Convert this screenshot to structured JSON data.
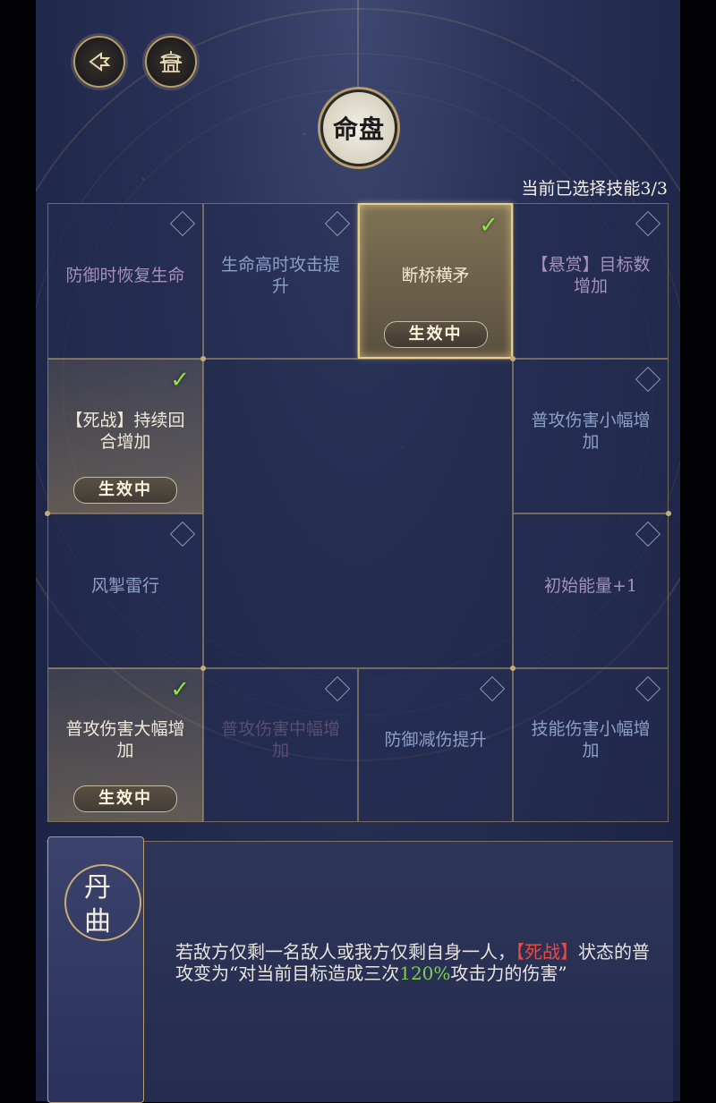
{
  "header": {
    "back_icon": "back-arrow-icon",
    "home_icon": "pavilion-icon",
    "emblem_title": "命盘",
    "selection_count": "当前已选择技能3/3"
  },
  "skills": [
    {
      "name": "防御时恢复生命",
      "state": "unselected",
      "color": "purple"
    },
    {
      "name": "生命高时攻击提升",
      "state": "unselected",
      "color": "blue"
    },
    {
      "name": "断桥横矛",
      "state": "selected",
      "badge": "生效中"
    },
    {
      "name": "【悬赏】目标数增加",
      "state": "unselected",
      "color": "purple"
    },
    {
      "name": "【死战】持续回合增加",
      "state": "selected",
      "badge": "生效中"
    },
    {
      "name": "普攻伤害小幅增加",
      "state": "unselected",
      "color": "blue"
    },
    {
      "name": "风掣雷行",
      "state": "unselected",
      "color": "blue"
    },
    {
      "name": "初始能量+1",
      "state": "unselected",
      "color": "purple"
    },
    {
      "name": "普攻伤害大幅增加",
      "state": "selected",
      "badge": "生效中"
    },
    {
      "name": "普攻伤害中幅增加",
      "state": "unselected",
      "color": "dim"
    },
    {
      "name": "防御减伤提升",
      "state": "unselected",
      "color": "blue"
    },
    {
      "name": "技能伤害小幅增加",
      "state": "unselected",
      "color": "blue"
    }
  ],
  "detail": {
    "title": "丹曲",
    "text_part1": "若敌方仅剩一名敌人或我方仅剩自身一人，",
    "text_highlight_red": "【死战】",
    "text_part2": "状态的普攻变为“对当前目标造成三次",
    "text_highlight_green": "120%",
    "text_part3": "攻击力的伤害”"
  },
  "colors": {
    "accent_gold": "#b79e6a",
    "check_green": "#8de34a",
    "highlight_red": "#e84b44",
    "highlight_green": "#7fcf52"
  }
}
